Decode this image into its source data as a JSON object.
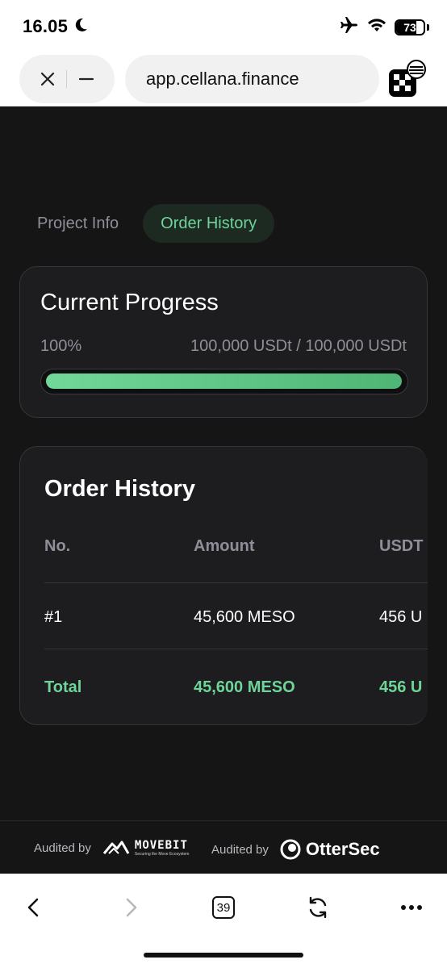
{
  "status_bar": {
    "time": "16.05",
    "battery_level": "73",
    "icons": [
      "moon-icon",
      "airplane-icon",
      "wifi-icon",
      "battery-icon"
    ]
  },
  "browser": {
    "url": "app.cellana.finance",
    "icons": [
      "close-icon",
      "minimize-icon",
      "okx-logo-icon"
    ]
  },
  "tabs": [
    {
      "label": "Project Info",
      "active": false
    },
    {
      "label": "Order History",
      "active": true
    }
  ],
  "progress": {
    "title": "Current Progress",
    "percent_label": "100%",
    "amounts_label": "100,000 USDt / 100,000 USDt",
    "fraction": 1.0
  },
  "order_history": {
    "title": "Order History",
    "columns": [
      "No.",
      "Amount",
      "USDT"
    ],
    "rows": [
      [
        "#1",
        "45,600 MESO",
        "456 U"
      ]
    ],
    "total": [
      "Total",
      "45,600 MESO",
      "456 U"
    ]
  },
  "footer": {
    "audit_label_1": "Audited by",
    "auditor_1": "MOVEBIT",
    "auditor_1_tagline": "Securing the Move Ecosystem",
    "audit_label_2": "Audited by",
    "auditor_2": "OtterSec"
  },
  "nav": {
    "tab_count": "39",
    "icons": [
      "back-icon",
      "forward-icon",
      "tabs-icon",
      "reload-icon",
      "more-icon"
    ]
  },
  "colors": {
    "accent": "#6fd49a",
    "background": "#151515",
    "card": "#1d1d1f",
    "muted_text": "#8e8f99"
  }
}
